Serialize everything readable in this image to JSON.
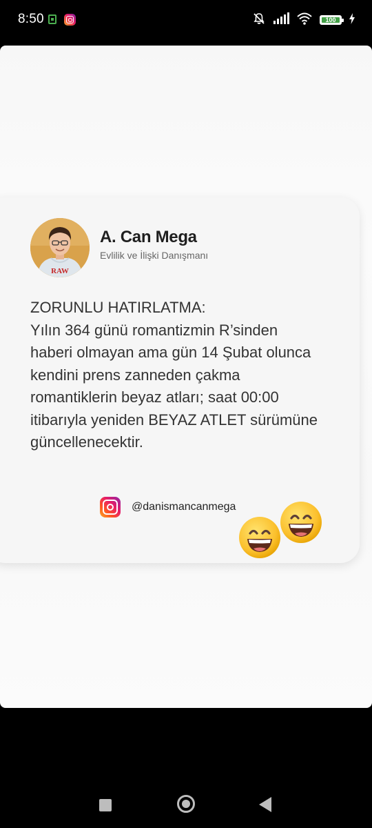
{
  "status_bar": {
    "time": "8:50",
    "battery_level": "100",
    "icons": [
      "notification-green-icon",
      "instagram-notification-icon",
      "silent-bell-icon",
      "signal-icon",
      "wifi-icon",
      "battery-icon",
      "charging-bolt-icon"
    ]
  },
  "post": {
    "author_name": "A. Can Mega",
    "author_title": "Evlilik ve İlişki Danışmanı",
    "avatar_shirt_text": "RAW",
    "body": "ZORUNLU HATIRLATMA:\n Yılın 364 günü romantizmin R’sinden haberi olmayan ama gün 14 Şubat olunca kendini prens zanneden çakma romantiklerin beyaz atları; saat 00:00 itibarıyla yeniden BEYAZ ATLET sürümüne güncellenecektir.",
    "instagram_handle": "@danismancanmega",
    "emojis": [
      "grinning-smiling-eyes-emoji",
      "grinning-smiling-eyes-emoji"
    ]
  },
  "nav_bar": {
    "buttons": [
      "recents-button",
      "home-button",
      "back-button"
    ]
  },
  "colors": {
    "background": "#000000",
    "content_bg": "#f8f8f8",
    "card_bg": "#f6f6f6",
    "text_primary": "#333333",
    "battery_green": "#43a047"
  }
}
